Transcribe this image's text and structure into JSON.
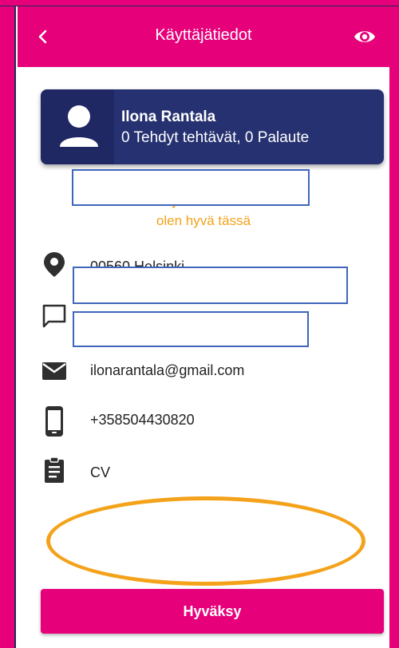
{
  "header": {
    "title": "Käyttäjätiedot",
    "back_icon": "chevron-left-icon",
    "view_icon": "eye-icon"
  },
  "user": {
    "name": "Ilona Rantala",
    "stats": "0 Tehdyt tehtävät, 0 Palaute"
  },
  "comment": {
    "heading": "Tekijän kommentti",
    "text": "olen hyvä tässä"
  },
  "details": {
    "location": "00560 Helsinki",
    "email": "ilonarantala@gmail.com",
    "phone": "+358504430820",
    "cv": "CV"
  },
  "actions": {
    "accept_label": "Hyväksy"
  },
  "colors": {
    "brand": "#e6007a",
    "card": "#263171",
    "accent": "#f4a21a"
  }
}
